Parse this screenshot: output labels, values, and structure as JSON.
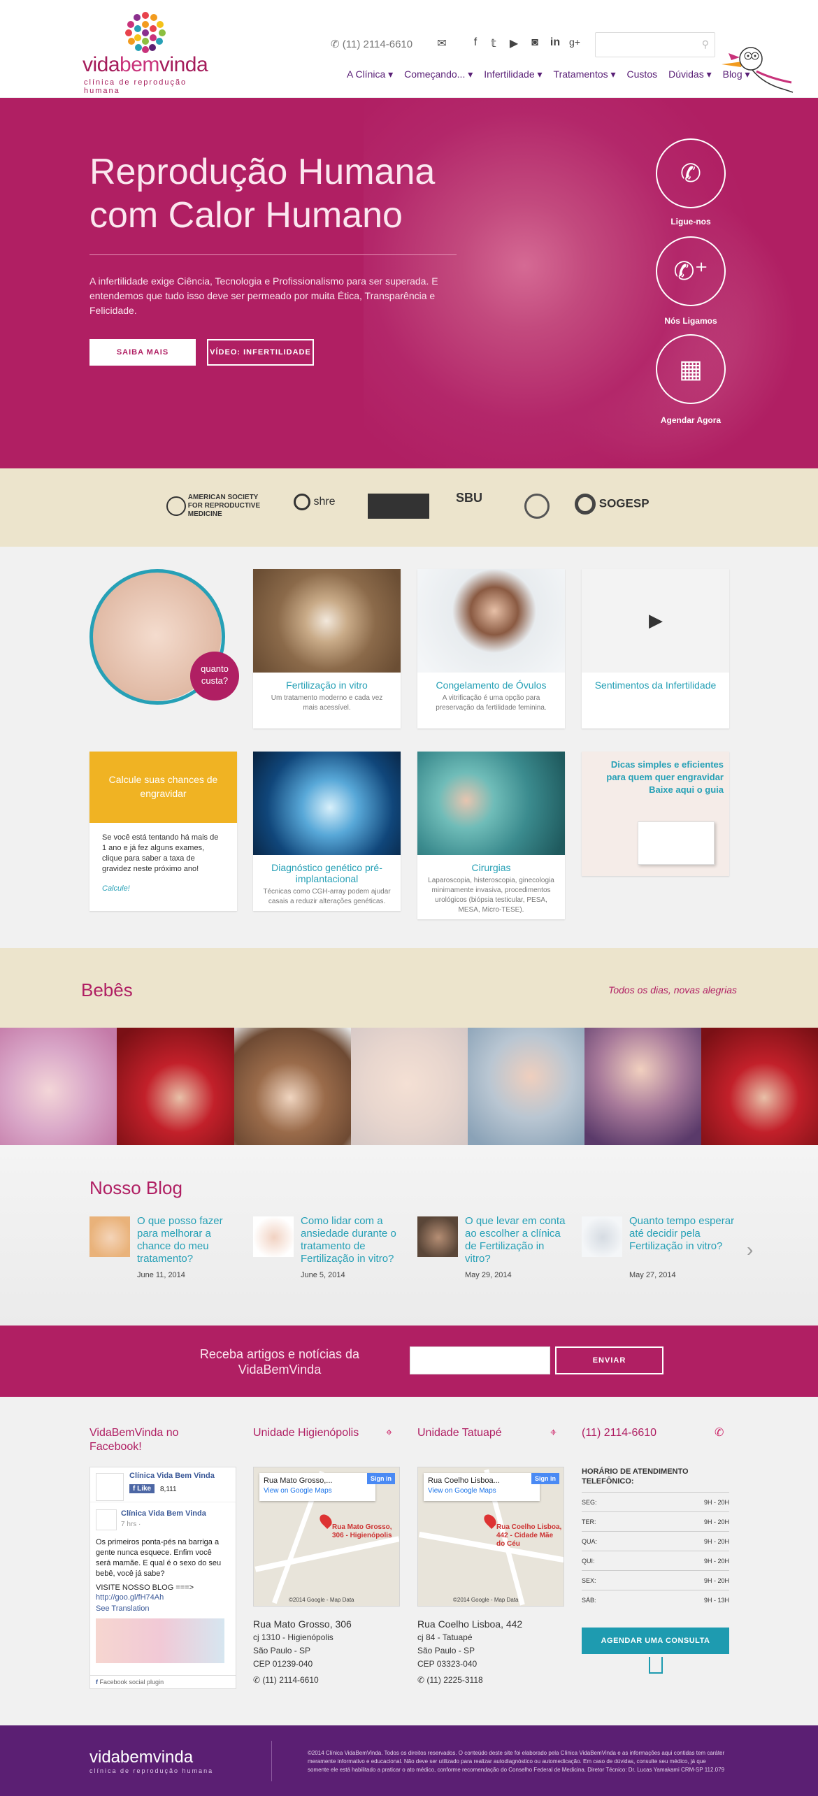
{
  "header": {
    "logo_word_a": "vida",
    "logo_word_b": "bem",
    "logo_word_c": "vinda",
    "logo_sub": "clínica de reprodução humana",
    "phone": "(11) 2114-6610",
    "social_icons": [
      "mail-icon",
      "facebook-icon",
      "twitter-icon",
      "youtube-icon",
      "instagram-icon",
      "linkedin-icon",
      "googleplus-icon"
    ],
    "nav": [
      "A Clínica ▾",
      "Começando... ▾",
      "Infertilidade ▾",
      "Tratamentos ▾",
      "Custos",
      "Dúvidas ▾",
      "Blog ▾"
    ]
  },
  "hero": {
    "title": "Reprodução Humana com Calor Humano",
    "text": "A infertilidade exige Ciência, Tecnologia e Profissionalismo para ser superada. E entendemos que tudo isso deve ser permeado por muita Ética, Transparência e Felicidade.",
    "btn_saiba": "SAIBA MAIS",
    "btn_video": "VÍDEO: INFERTILIDADE",
    "actions": [
      "Ligue-nos",
      "Nós Ligamos",
      "Agendar Agora"
    ]
  },
  "associations": [
    "AMERICAN SOCIETY FOR REPRODUCTIVE MEDICINE",
    "shre",
    "",
    "",
    "SBU",
    "",
    "SOGESP"
  ],
  "services": {
    "quanto": "quanto custa?",
    "cards": [
      {
        "title": "Fertilização in vitro",
        "desc": "Um tratamento moderno e cada vez mais acessível."
      },
      {
        "title": "Congelamento de Óvulos",
        "desc": "A vitrificação é uma opção para preservação da fertilidade feminina."
      },
      {
        "title": "Sentimentos da Infertilidade",
        "desc": ""
      },
      {
        "title": "Diagnóstico genético pré-implantacional",
        "desc": "Técnicas como CGH-array podem ajudar casais a reduzir alterações genéticas."
      },
      {
        "title": "Cirurgias",
        "desc": "Laparoscopia, histeroscopia, ginecologia minimamente invasiva, procedimentos urológicos (biópsia testicular, PESA, MESA, Micro-TESE)."
      }
    ],
    "calc_head": "Calcule suas chances de engravidar",
    "calc_body": "Se você está tentando há mais de 1 ano e já fez alguns exames, clique para saber a taxa de gravidez neste próximo ano!",
    "calc_link": "Calcule!",
    "guia": "Dicas simples e eficientes para quem quer engravidar Baixe aqui o guia"
  },
  "bebes": {
    "title": "Bebês",
    "tagline": "Todos os dias, novas alegrias"
  },
  "blog": {
    "title": "Nosso Blog",
    "posts": [
      {
        "title": "O que posso fazer para melhorar a chance do meu tratamento?",
        "date": "June 11, 2014"
      },
      {
        "title": "Como lidar com a ansiedade durante o tratamento de Fertilização in vitro?",
        "date": "June 5, 2014"
      },
      {
        "title": "O que levar em conta ao escolher a clínica de Fertilização in vitro?",
        "date": "May 29, 2014"
      },
      {
        "title": "Quanto tempo esperar até decidir pela Fertilização in vitro?",
        "date": "May 27, 2014"
      }
    ]
  },
  "newsletter": {
    "text": "Receba artigos e notícias da VidaBemVinda",
    "button": "ENVIAR"
  },
  "info": {
    "fb_head": "VidaBemVinda no Facebook!",
    "fb_page": "Clínica Vida Bem Vinda",
    "fb_like": "Like",
    "fb_count": "8,111",
    "fb_post_time": "7 hrs ·",
    "fb_post": "Os primeiros ponta-pés na barriga a gente nunca esquece. Enfim você será mamãe. E qual é o sexo do seu bebê, você já sabe?",
    "fb_visit": "VISITE NOSSO BLOG ===>",
    "fb_link": "http://goo.gl/fH74Ah",
    "fb_translate": "See Translation",
    "fb_plugin": "Facebook social plugin",
    "u1_head": "Unidade Higienópolis",
    "u1_pop": "Rua Mato Grosso,...",
    "u1_label": "Rua Mato Grosso, 306 - Higienópolis",
    "u1_addr1": "Rua Mato Grosso, 306",
    "u1_addr2": "cj 1310 - Higienópolis",
    "u1_addr3": "São Paulo - SP",
    "u1_addr4": "CEP 01239-040",
    "u1_phone": "(11) 2114-6610",
    "u2_head": "Unidade Tatuapé",
    "u2_pop": "Rua Coelho Lisboa...",
    "u2_label": "Rua Coelho Lisboa, 442 - Cidade Mãe do Céu",
    "u2_addr1": "Rua Coelho Lisboa, 442",
    "u2_addr2": "cj 84 - Tatuapé",
    "u2_addr3": "São Paulo - SP",
    "u2_addr4": "CEP 03323-040",
    "u2_phone": "(11) 2225-3118",
    "map_link": "View on Google Maps",
    "map_signin": "Sign in",
    "map_copy": "©2014 Google - Map Data",
    "tel_head": "(11) 2114-6610",
    "hours_head": "HORÁRIO DE ATENDIMENTO TELEFÔNICO:",
    "hours": [
      {
        "day": "SEG:",
        "time": "9H - 20H"
      },
      {
        "day": "TER:",
        "time": "9H - 20H"
      },
      {
        "day": "QUA:",
        "time": "9H - 20H"
      },
      {
        "day": "QUI:",
        "time": "9H - 20H"
      },
      {
        "day": "SEX:",
        "time": "9H - 20H"
      },
      {
        "day": "SÁB:",
        "time": "9H - 13H"
      }
    ],
    "agendar": "AGENDAR UMA CONSULTA"
  },
  "footer": {
    "logo": "vidabemvinda",
    "logo_sub": "clínica de reprodução humana",
    "text": "©2014 Clínica VidaBemVinda. Todos os direitos reservados. O conteúdo deste site foi elaborado pela Clínica VidaBemVinda e as informações aqui contidas tem caráter meramente informativo e educacional. Não deve ser utilizado para realizar autodiagnóstico ou automedicação. Em caso de dúvidas, consulte seu médico, já que somente ele está habilitado a praticar o ato médico, conforme recomendação do Conselho Federal de Medicina. Diretor Técnico: Dr. Lucas Yamakami CRM-SP 112.079"
  },
  "colors": {
    "brand": "#b01f63",
    "teal": "#26a0b6",
    "purple": "#5b1f73",
    "sand": "#ece4cc"
  }
}
